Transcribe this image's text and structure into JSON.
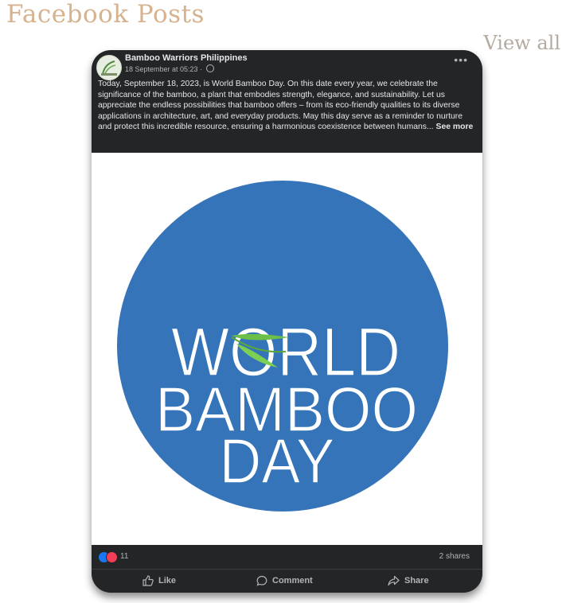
{
  "section": {
    "title": "Facebook Posts",
    "view_all": "View all"
  },
  "post": {
    "page_name": "Bamboo Warriors Philippines",
    "timestamp": "18 September at 05:23",
    "meta_separator": " · ",
    "more_icon": "more-options-icon",
    "text": "Today, September 18, 2023, is World Bamboo Day. On this date every year, we celebrate the significance of the bamboo, a plant that embodies strength, elegance, and sustainability. Let us appreciate the endless possibilities that bamboo offers – from its eco-friendly qualities to its diverse applications in architecture, art, and everyday products. May this day serve as a reminder to nurture and protect this incredible resource, ensuring a harmonious coexistence between humans...",
    "see_more": "See more",
    "image": {
      "line1": "WORLD",
      "line2": "BAMBOO",
      "line3": "DAY",
      "circle_color": "#3574b8",
      "leaf_color": "#6cc04a"
    },
    "reaction_count": "11",
    "shares": "2 shares",
    "actions": {
      "like": "Like",
      "comment": "Comment",
      "share": "Share"
    }
  },
  "colors": {
    "card_bg": "#242526",
    "title": "#d6b28e",
    "view_all": "#b5aaa0",
    "like_blue": "#1877f2",
    "love_red": "#f33e58"
  }
}
